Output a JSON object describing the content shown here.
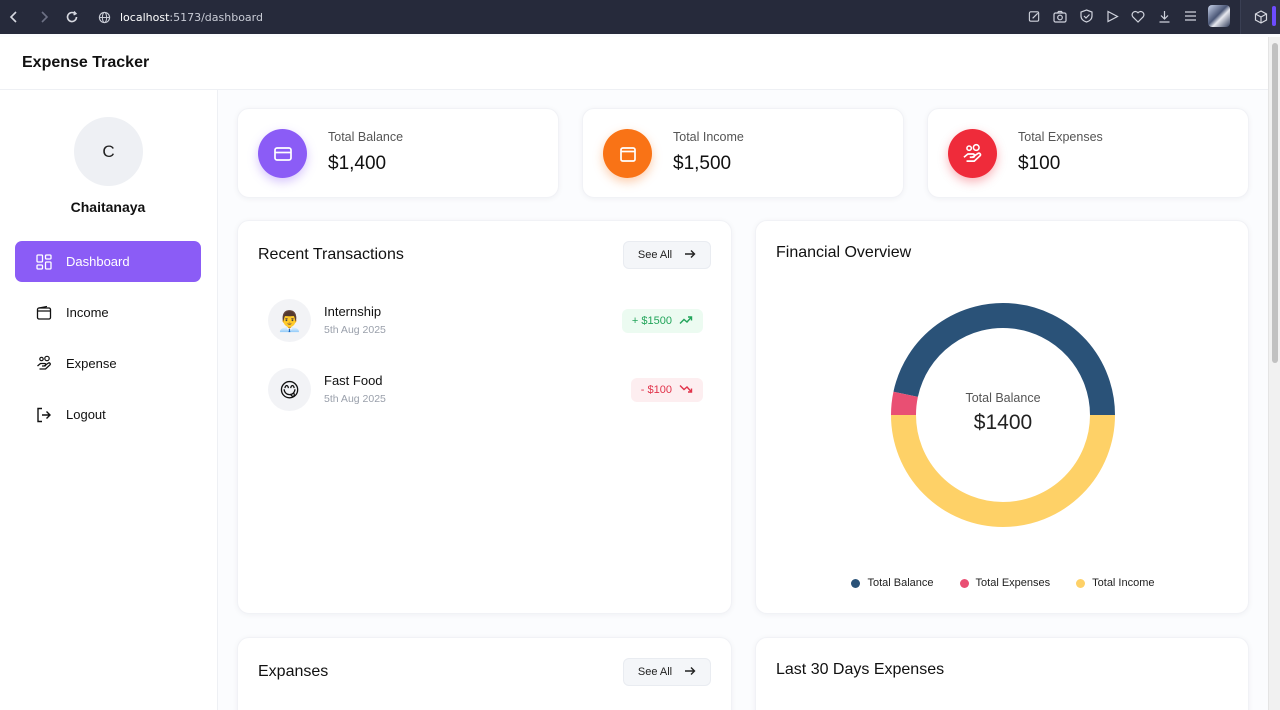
{
  "browser": {
    "url_host": "localhost",
    "url_path": ":5173/dashboard"
  },
  "app": {
    "title": "Expense Tracker"
  },
  "user": {
    "initial": "C",
    "name": "Chaitanaya"
  },
  "sidebar": {
    "items": [
      {
        "label": "Dashboard",
        "icon": "grid-icon",
        "active": true
      },
      {
        "label": "Income",
        "icon": "wallet-icon",
        "active": false
      },
      {
        "label": "Expense",
        "icon": "hand-coins-icon",
        "active": false
      },
      {
        "label": "Logout",
        "icon": "logout-icon",
        "active": false
      }
    ]
  },
  "stats": [
    {
      "label": "Total Balance",
      "value": "$1,400",
      "color": "#8b5cf6",
      "icon": "credit-card-icon"
    },
    {
      "label": "Total Income",
      "value": "$1,500",
      "color": "#f97316",
      "icon": "wallet-icon"
    },
    {
      "label": "Total Expenses",
      "value": "$100",
      "color": "#ef2b3a",
      "icon": "hand-coins-icon"
    }
  ],
  "recent": {
    "title": "Recent Transactions",
    "see_all": "See All",
    "items": [
      {
        "name": "Internship",
        "date": "5th Aug 2025",
        "amount": "+ $1500",
        "type": "income",
        "emoji": "👨‍💼"
      },
      {
        "name": "Fast Food",
        "date": "5th Aug 2025",
        "amount": "- $100",
        "type": "expense",
        "emoji": "😋"
      }
    ]
  },
  "overview": {
    "title": "Financial Overview",
    "center_label": "Total Balance",
    "center_value": "$1400",
    "legend": [
      {
        "label": "Total Balance",
        "color": "#2a5278"
      },
      {
        "label": "Total Expenses",
        "color": "#e94f73"
      },
      {
        "label": "Total Income",
        "color": "#fed167"
      }
    ]
  },
  "chart_data": {
    "type": "pie",
    "categories": [
      "Total Balance",
      "Total Expenses",
      "Total Income"
    ],
    "values": [
      1400,
      100,
      1500
    ],
    "title": "Financial Overview"
  },
  "expenses": {
    "title": "Expanses",
    "see_all": "See All"
  },
  "last30": {
    "title": "Last 30 Days Expenses"
  }
}
